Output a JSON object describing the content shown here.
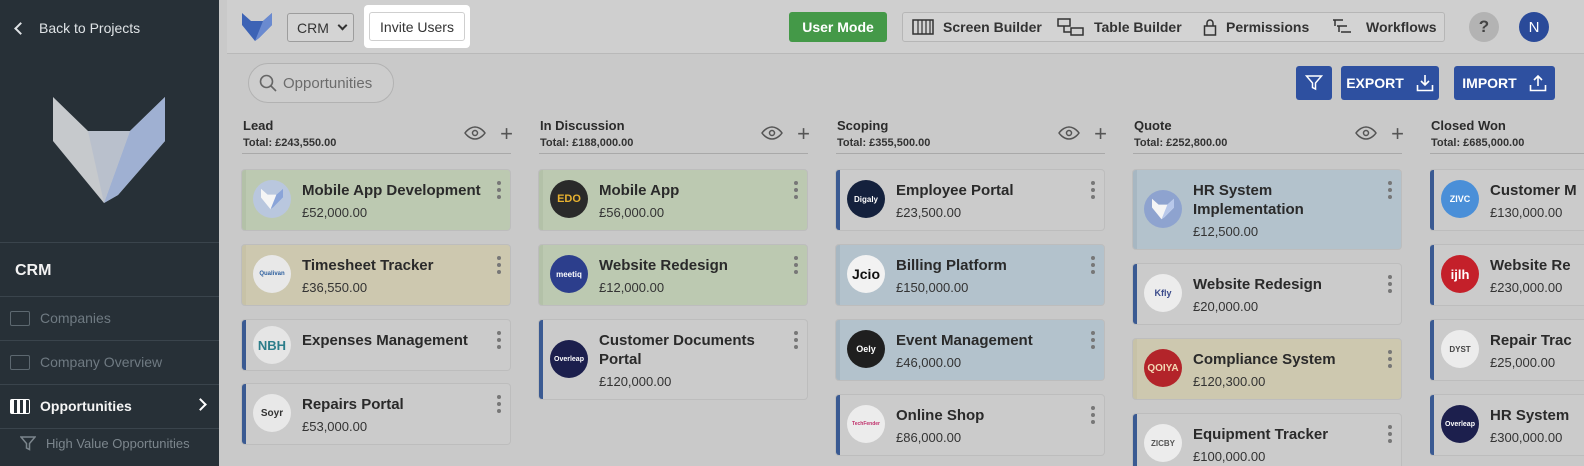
{
  "sidebar": {
    "back_label": "Back to Projects",
    "app_title": "CRM",
    "items": [
      {
        "label": "Companies"
      },
      {
        "label": "Company Overview"
      },
      {
        "label": "Opportunities"
      }
    ],
    "sub_item": "High Value Opportunities"
  },
  "topbar": {
    "app_select": "CRM",
    "invite": "Invite Users",
    "user_mode": "User Mode",
    "tools": [
      "Screen Builder",
      "Table Builder",
      "Permissions",
      "Workflows"
    ],
    "help": "?",
    "avatar": "N"
  },
  "toolbar": {
    "search_placeholder": "Opportunities",
    "export": "EXPORT",
    "import": "IMPORT"
  },
  "colors": {
    "accent": "#2e50a0",
    "user_mode": "#449948",
    "sidebar": "#273037"
  },
  "columns": [
    {
      "name": "Lead",
      "total": "Total: £243,550.00",
      "cards": [
        {
          "title": "Mobile App Development",
          "amount": "£52,000.00",
          "logo": "VF",
          "color": "green"
        },
        {
          "title": "Timesheet Tracker",
          "amount": "£36,550.00",
          "logo": "Qualivan",
          "color": "yellow"
        },
        {
          "title": "Expenses Management",
          "amount": "",
          "logo": "NBH",
          "color": "grey"
        },
        {
          "title": "Repairs Portal",
          "amount": "£53,000.00",
          "logo": "Soyr",
          "color": "grey"
        }
      ]
    },
    {
      "name": "In Discussion",
      "total": "Total: £188,000.00",
      "cards": [
        {
          "title": "Mobile App",
          "amount": "£56,000.00",
          "logo": "EDO",
          "color": "green"
        },
        {
          "title": "Website Redesign",
          "amount": "£12,000.00",
          "logo": "meetiq",
          "color": "green"
        },
        {
          "title": "Customer Documents Portal",
          "amount": "£120,000.00",
          "logo": "Overleap",
          "color": "grey"
        }
      ]
    },
    {
      "name": "Scoping",
      "total": "Total: £355,500.00",
      "cards": [
        {
          "title": "Employee Portal",
          "amount": "£23,500.00",
          "logo": "Digaly",
          "color": "grey"
        },
        {
          "title": "Billing Platform",
          "amount": "£150,000.00",
          "logo": "Jcio",
          "color": "blue"
        },
        {
          "title": "Event Management",
          "amount": "£46,000.00",
          "logo": "Oely",
          "color": "blue"
        },
        {
          "title": "Online Shop",
          "amount": "£86,000.00",
          "logo": "TechFender",
          "color": "grey"
        }
      ]
    },
    {
      "name": "Quote",
      "total": "Total: £252,800.00",
      "cards": [
        {
          "title": "HR System Implementation",
          "amount": "£12,500.00",
          "logo": "VF",
          "color": "blue"
        },
        {
          "title": "Website Redesign",
          "amount": "£20,000.00",
          "logo": "Kfly",
          "color": "grey"
        },
        {
          "title": "Compliance System",
          "amount": "£120,300.00",
          "logo": "QOIYA",
          "color": "yellow"
        },
        {
          "title": "Equipment Tracker",
          "amount": "£100,000.00",
          "logo": "ZICBY",
          "color": "grey"
        }
      ]
    },
    {
      "name": "Closed Won",
      "total": "Total: £685,000.00",
      "cards": [
        {
          "title": "Customer M",
          "amount": "£130,000.00",
          "logo": "ZIVC",
          "color": "grey"
        },
        {
          "title": "Website Re",
          "amount": "£230,000.00",
          "logo": "ijlh",
          "color": "grey"
        },
        {
          "title": "Repair Trac",
          "amount": "£25,000.00",
          "logo": "DYST",
          "color": "grey"
        },
        {
          "title": "HR System",
          "amount": "£300,000.00",
          "logo": "Overleap",
          "color": "grey"
        }
      ]
    }
  ]
}
